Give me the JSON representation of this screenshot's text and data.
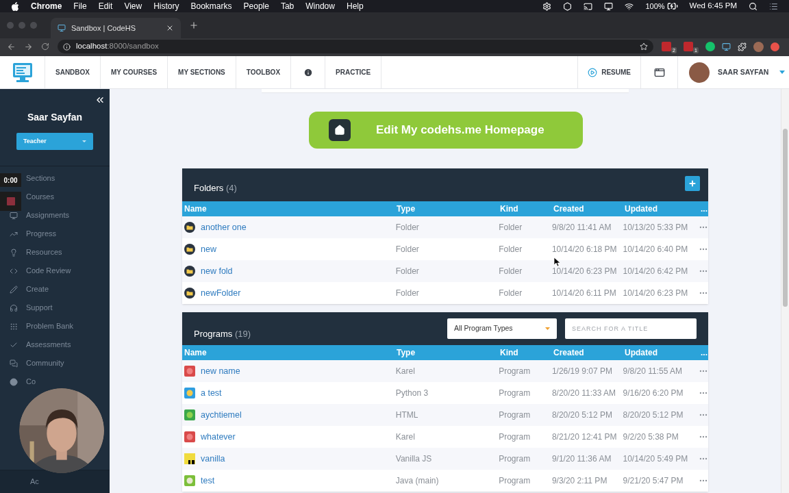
{
  "menubar": {
    "app": "Chrome",
    "menus": [
      "File",
      "Edit",
      "View",
      "History",
      "Bookmarks",
      "People",
      "Tab",
      "Window",
      "Help"
    ],
    "battery": "100%",
    "clock": "Wed 6:45 PM"
  },
  "browser": {
    "tab_title": "Sandbox | CodeHS",
    "url_host": "localhost",
    "url_path": ":8000/sandbox",
    "extension_badges": [
      "2",
      "1"
    ]
  },
  "nav": {
    "items": [
      {
        "kind": "text",
        "label": "SANDBOX"
      },
      {
        "kind": "text",
        "label": "MY COURSES"
      },
      {
        "kind": "text",
        "label": "MY SECTIONS"
      },
      {
        "kind": "text",
        "label": "TOOLBOX"
      },
      {
        "kind": "info"
      },
      {
        "kind": "text",
        "label": "PRACTICE"
      }
    ],
    "resume": "RESUME",
    "user": "SAAR SAYFAN"
  },
  "sidebar": {
    "name": "Saar Sayfan",
    "role": "Teacher",
    "items": [
      {
        "label": "Sections"
      },
      {
        "label": "Courses"
      },
      {
        "label": "Assignments"
      },
      {
        "label": "Progress"
      },
      {
        "label": "Resources"
      },
      {
        "label": "Code Review"
      },
      {
        "label": "Create"
      },
      {
        "label": "Support"
      },
      {
        "label": "Problem Bank"
      },
      {
        "label": "Assessments"
      },
      {
        "label": "Community"
      },
      {
        "label": "Co"
      }
    ],
    "footer": "Ac"
  },
  "recorder": {
    "timer": "0:00"
  },
  "homepage_button": "Edit My codehs.me Homepage",
  "folders": {
    "title": "Folders",
    "count": "(4)",
    "columns": [
      "Name",
      "Type",
      "Kind",
      "Created",
      "Updated",
      "..."
    ],
    "rows": [
      {
        "name": "another one",
        "type": "Folder",
        "kind": "Folder",
        "created": "9/8/20 11:41 AM",
        "updated": "10/13/20 5:33 PM"
      },
      {
        "name": "new",
        "type": "Folder",
        "kind": "Folder",
        "created": "10/14/20 6:18 PM",
        "updated": "10/14/20 6:40 PM"
      },
      {
        "name": "new fold",
        "type": "Folder",
        "kind": "Folder",
        "created": "10/14/20 6:23 PM",
        "updated": "10/14/20 6:42 PM"
      },
      {
        "name": "newFolder",
        "type": "Folder",
        "kind": "Folder",
        "created": "10/14/20 6:11 PM",
        "updated": "10/14/20 6:23 PM"
      }
    ]
  },
  "programs": {
    "title": "Programs",
    "count": "(19)",
    "filter": "All Program Types",
    "search_placeholder": "SEARCH FOR A TITLE",
    "columns": [
      "Name",
      "Type",
      "Kind",
      "Created",
      "Updated",
      "..."
    ],
    "rows": [
      {
        "name": "new name",
        "type": "Karel",
        "kind": "Program",
        "created": "1/26/19 9:07 PM",
        "updated": "9/8/20 11:55 AM"
      },
      {
        "name": "a test",
        "type": "Python 3",
        "kind": "Program",
        "created": "8/20/20 11:33 AM",
        "updated": "9/16/20 6:20 PM"
      },
      {
        "name": "aychtiemel",
        "type": "HTML",
        "kind": "Program",
        "created": "8/20/20 5:12 PM",
        "updated": "8/20/20 5:12 PM"
      },
      {
        "name": "whatever",
        "type": "Karel",
        "kind": "Program",
        "created": "8/21/20 12:41 PM",
        "updated": "9/2/20 5:38 PM"
      },
      {
        "name": "vanilla",
        "type": "Vanilla JS",
        "kind": "Program",
        "created": "9/1/20 11:36 AM",
        "updated": "10/14/20 5:49 PM"
      },
      {
        "name": "test",
        "type": "Java (main)",
        "kind": "Program",
        "created": "9/3/20 2:11 PM",
        "updated": "9/21/20 5:47 PM"
      }
    ]
  }
}
